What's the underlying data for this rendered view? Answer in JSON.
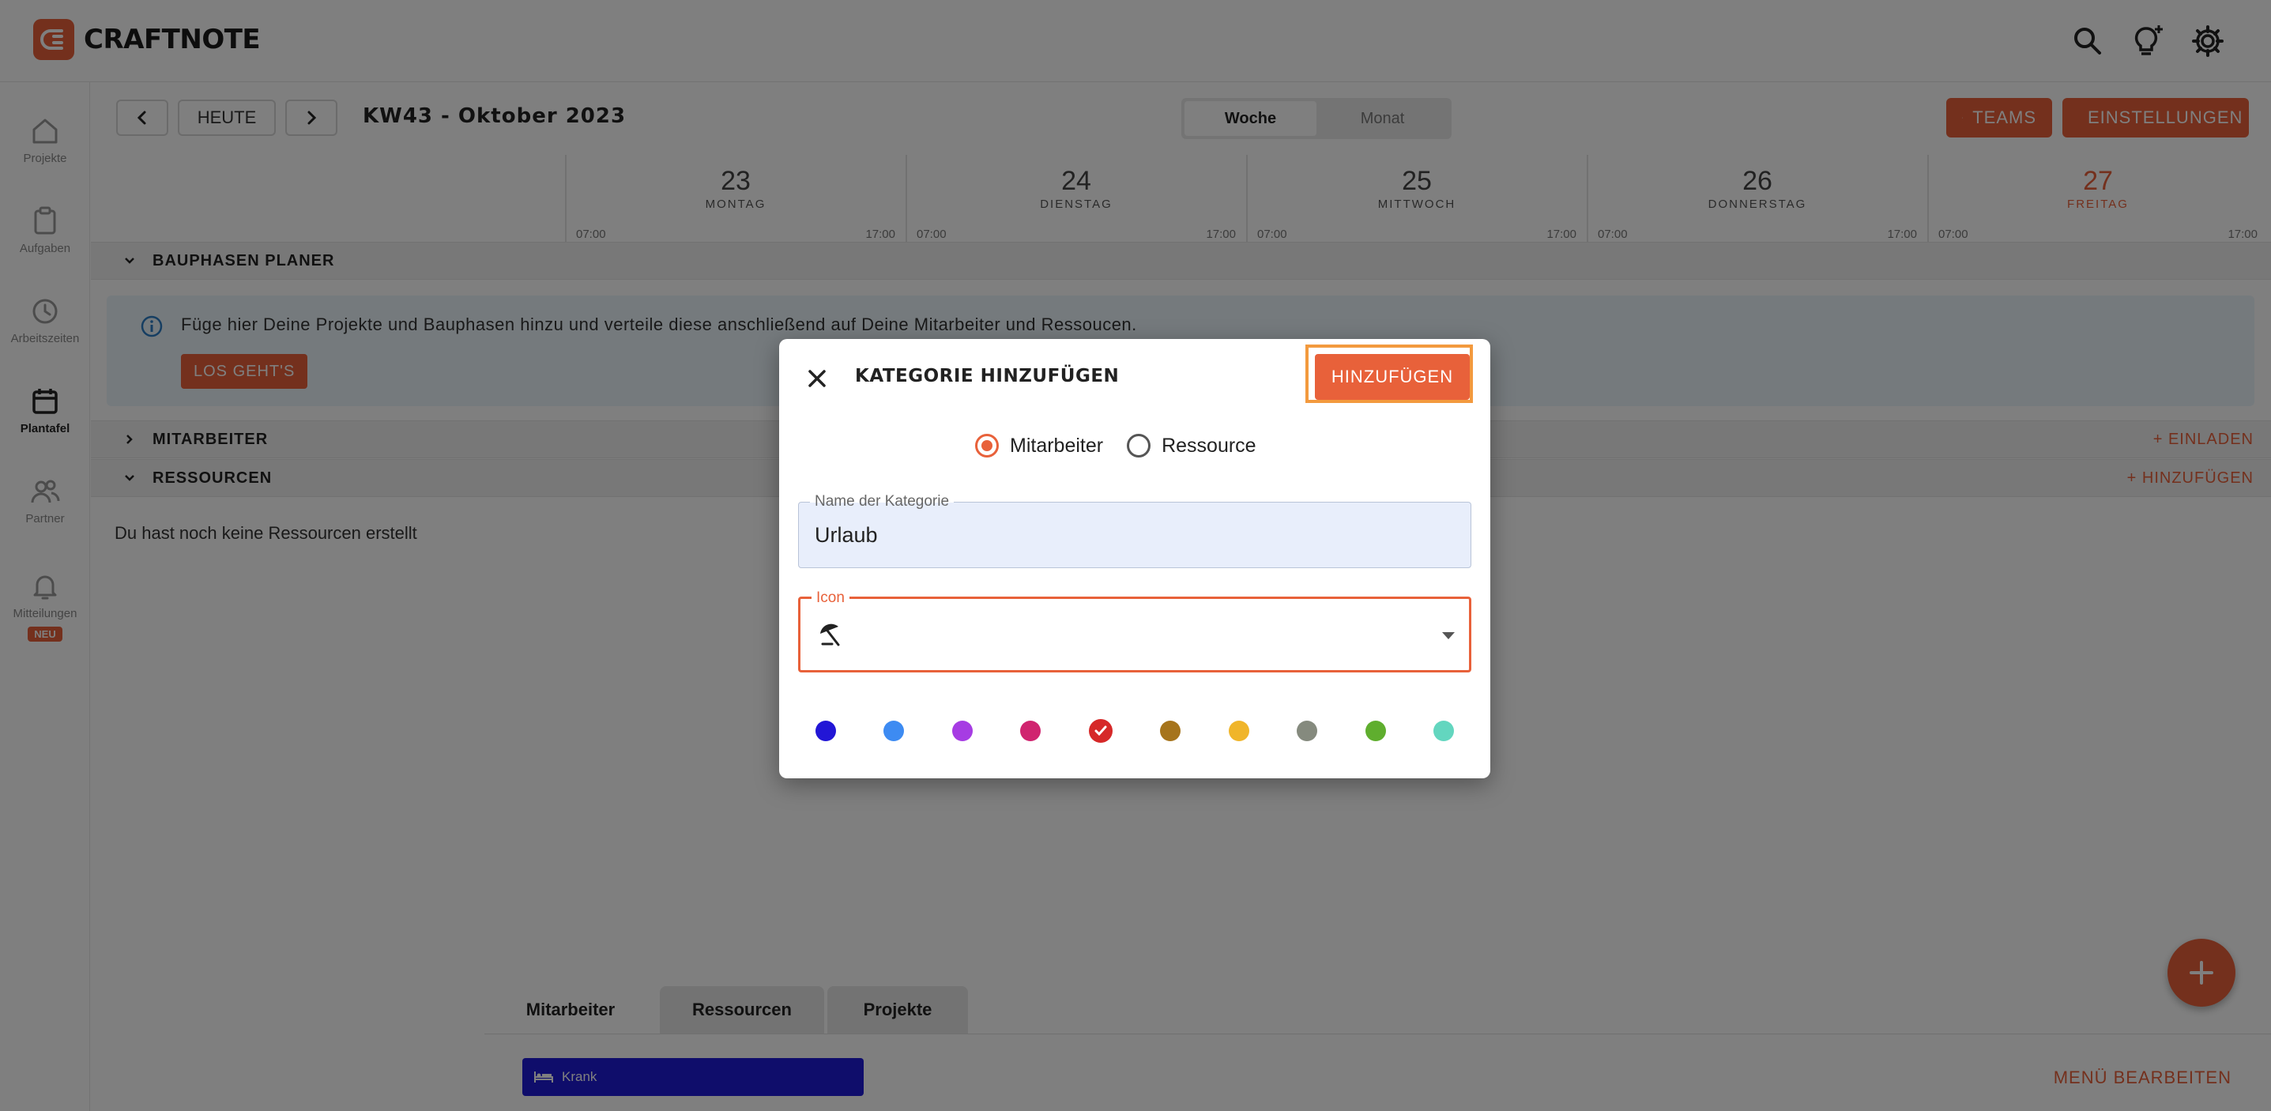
{
  "app": {
    "brand": "CRAFTNOTE"
  },
  "sidebar": {
    "items": [
      {
        "label": "Projekte",
        "icon": "home-icon"
      },
      {
        "label": "Aufgaben",
        "icon": "clipboard-icon"
      },
      {
        "label": "Arbeitszeiten",
        "icon": "clock-icon"
      },
      {
        "label": "Plantafel",
        "icon": "calendar-icon",
        "active": true
      },
      {
        "label": "Partner",
        "icon": "partner-icon"
      },
      {
        "label": "Mitteilungen",
        "icon": "bell-icon",
        "badge": "NEU"
      }
    ]
  },
  "toolbar": {
    "today_label": "HEUTE",
    "week_title": "KW43 - Oktober 2023",
    "view_week": "Woche",
    "view_month": "Monat",
    "teams_label": "TEAMS",
    "settings_label": "EINSTELLUNGEN"
  },
  "days": [
    {
      "num": "23",
      "name": "MONTAG",
      "start": "07:00",
      "end": "17:00"
    },
    {
      "num": "24",
      "name": "DIENSTAG",
      "start": "07:00",
      "end": "17:00"
    },
    {
      "num": "25",
      "name": "MITTWOCH",
      "start": "07:00",
      "end": "17:00"
    },
    {
      "num": "26",
      "name": "DONNERSTAG",
      "start": "07:00",
      "end": "17:00"
    },
    {
      "num": "27",
      "name": "FREITAG",
      "start": "07:00",
      "end": "17:00",
      "today": true
    }
  ],
  "sections": {
    "bauphasen": "BAUPHASEN PLANER",
    "info_text": "Füge hier Deine Projekte und Bauphasen hinzu und verteile diese anschließend auf Deine Mitarbeiter und Ressoucen.",
    "info_button": "LOS GEHT'S",
    "mitarbeiter": "MITARBEITER",
    "mitarbeiter_action": "+ EINLADEN",
    "ressourcen": "RESSOURCEN",
    "ressourcen_action": "+ HINZUFÜGEN",
    "empty_ressourcen": "Du hast noch keine Ressourcen erstellt"
  },
  "bottom": {
    "tabs": [
      "Mitarbeiter",
      "Ressourcen",
      "Projekte"
    ],
    "chip_label": "Krank",
    "menu_edit": "MENÜ BEARBEITEN"
  },
  "modal": {
    "title": "KATEGORIE HINZUFÜGEN",
    "add_button": "HINZUFÜGEN",
    "radio_mitarbeiter": "Mitarbeiter",
    "radio_ressource": "Ressource",
    "selected_radio": "Mitarbeiter",
    "name_label": "Name der Kategorie",
    "name_value": "Urlaub",
    "icon_label": "Icon",
    "icon_value": "beach-umbrella-icon",
    "colors": [
      "#2216d6",
      "#3d8bf2",
      "#a63ce3",
      "#d0246f",
      "#d62828",
      "#a6741c",
      "#f0b52a",
      "#858a7e",
      "#5fae2e",
      "#63d6bf"
    ],
    "selected_color": "#d62828"
  },
  "colors": {
    "accent": "#e8613a",
    "highlight": "#f39a3e"
  }
}
